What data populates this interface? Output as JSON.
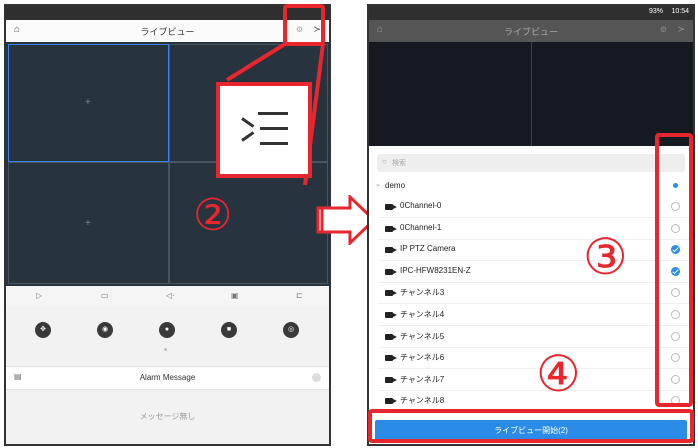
{
  "left_screen": {
    "title": "ライブビュー",
    "toolbar_icons": [
      "play-icon",
      "layout-icon",
      "volume-icon",
      "record-icon",
      "split-icon"
    ],
    "controls": [
      "ptz-icon",
      "snapshot-icon",
      "mic-icon",
      "record-video-icon",
      "fisheye-icon"
    ],
    "alarm_message_label": "Alarm Message",
    "empty_message": "メッセージ無し"
  },
  "zoom_icon": "menu-list-icon",
  "right_screen": {
    "status_time": "10:54",
    "status_battery": "93%",
    "title": "ライブビュー",
    "search_placeholder": "検索",
    "group_label": "demo",
    "channels": [
      {
        "name": "0Channel-0",
        "checked": false
      },
      {
        "name": "0Channel-1",
        "checked": false
      },
      {
        "name": "IP PTZ Camera",
        "checked": true
      },
      {
        "name": "IPC-HFW8231EN-Z",
        "checked": true
      },
      {
        "name": "チャンネル3",
        "checked": false
      },
      {
        "name": "チャンネル4",
        "checked": false
      },
      {
        "name": "チャンネル5",
        "checked": false
      },
      {
        "name": "チャンネル6",
        "checked": false
      },
      {
        "name": "チャンネル7",
        "checked": false
      },
      {
        "name": "チャンネル8",
        "checked": false
      }
    ],
    "start_button": "ライブビュー開始(2)"
  },
  "annotations": {
    "step2": "②",
    "step3": "③",
    "step4": "④"
  },
  "colors": {
    "annotation_red": "#e8262d",
    "accent_blue": "#2b8ce8",
    "video_bg": "#283340"
  }
}
